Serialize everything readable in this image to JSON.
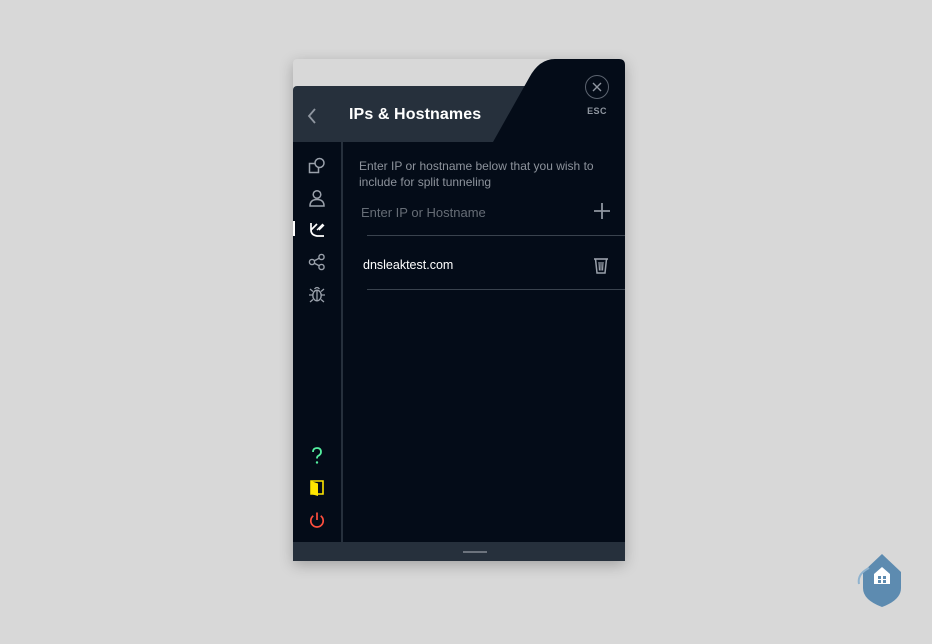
{
  "header": {
    "title": "IPs & Hostnames",
    "esc_label": "ESC"
  },
  "sidebar": {
    "items": [
      {
        "icon": "connection-icon"
      },
      {
        "icon": "account-icon"
      },
      {
        "icon": "split-tunneling-icon",
        "active": true
      },
      {
        "icon": "share-icon"
      },
      {
        "icon": "debug-icon"
      }
    ],
    "bottom": [
      {
        "icon": "help-icon",
        "color": "#55f0a0"
      },
      {
        "icon": "exit-door-icon",
        "color": "#ffe600"
      },
      {
        "icon": "power-icon",
        "color": "#ff4f3e"
      }
    ]
  },
  "content": {
    "description": "Enter IP or hostname below that you wish to include for split tunneling",
    "input": {
      "placeholder": "Enter IP or Hostname",
      "value": ""
    },
    "hosts": [
      "dnsleaktest.com"
    ]
  },
  "colors": {
    "panel": "#040c18",
    "header": "#26303c",
    "help": "#55f0a0",
    "exit": "#ffe600",
    "power": "#ff4f3e"
  }
}
